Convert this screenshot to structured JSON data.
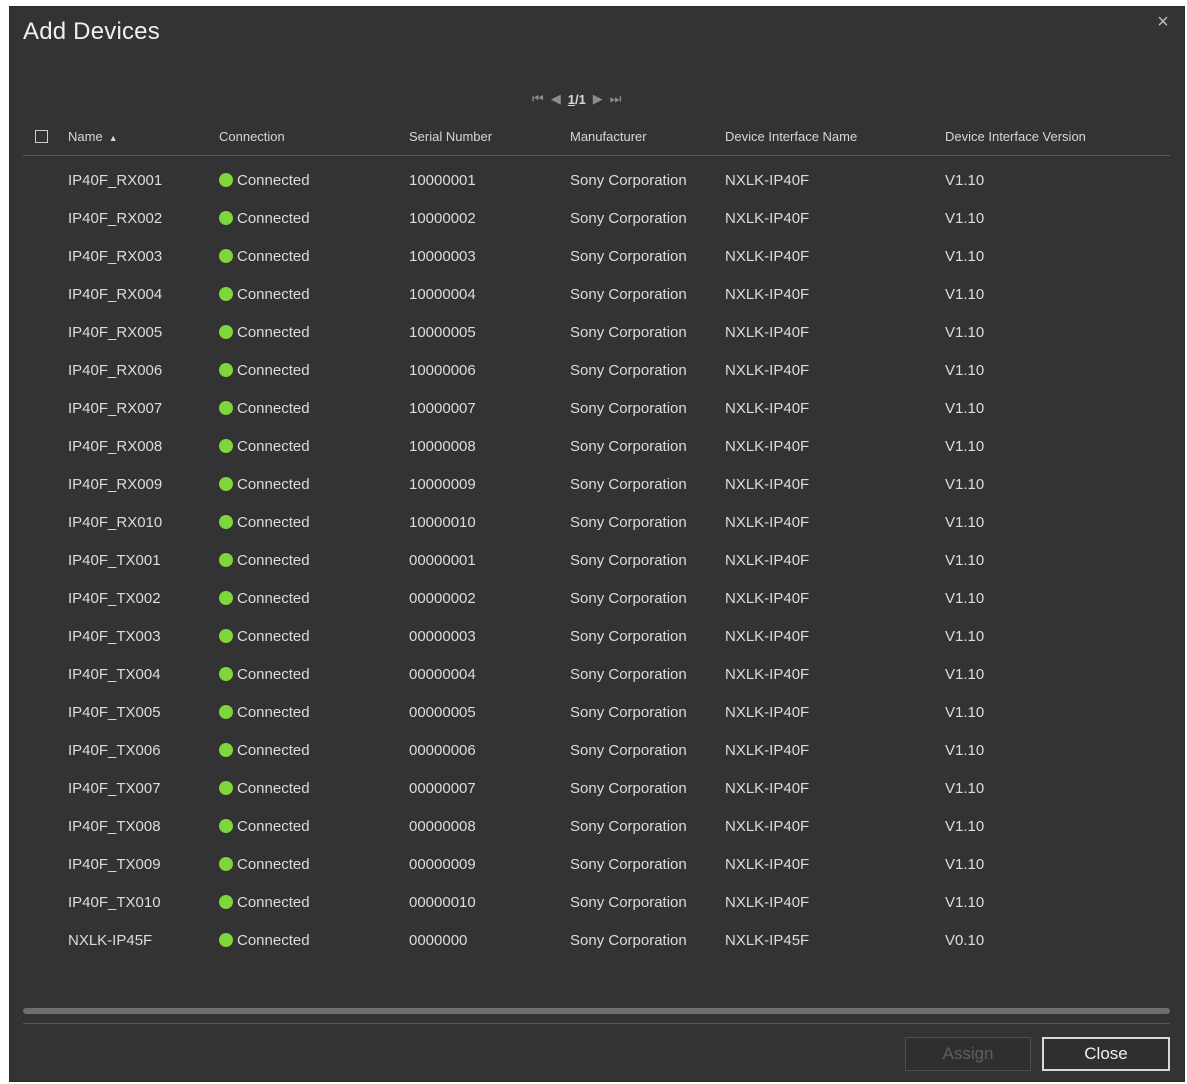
{
  "dialog": {
    "title": "Add Devices",
    "close_glyph": "×",
    "close_icon": "close-icon"
  },
  "pager": {
    "first_glyph": "⏮",
    "prev_glyph": "◀",
    "current": "1",
    "separator": "/",
    "total": "1",
    "next_glyph": "▶",
    "last_glyph": "⏭"
  },
  "table": {
    "headers": {
      "name": "Name",
      "connection": "Connection",
      "serial": "Serial Number",
      "manufacturer": "Manufacturer",
      "interface_name": "Device Interface Name",
      "interface_version": "Device Interface Version"
    },
    "sort": {
      "column": "name",
      "direction": "ascending",
      "glyph": "▲"
    },
    "status_color": "#7ed53c",
    "rows": [
      {
        "name": "IP40F_RX001",
        "connection": "Connected",
        "serial": "10000001",
        "manufacturer": "Sony Corporation",
        "interface_name": "NXLK-IP40F",
        "interface_version": "V1.10"
      },
      {
        "name": "IP40F_RX002",
        "connection": "Connected",
        "serial": "10000002",
        "manufacturer": "Sony Corporation",
        "interface_name": "NXLK-IP40F",
        "interface_version": "V1.10"
      },
      {
        "name": "IP40F_RX003",
        "connection": "Connected",
        "serial": "10000003",
        "manufacturer": "Sony Corporation",
        "interface_name": "NXLK-IP40F",
        "interface_version": "V1.10"
      },
      {
        "name": "IP40F_RX004",
        "connection": "Connected",
        "serial": "10000004",
        "manufacturer": "Sony Corporation",
        "interface_name": "NXLK-IP40F",
        "interface_version": "V1.10"
      },
      {
        "name": "IP40F_RX005",
        "connection": "Connected",
        "serial": "10000005",
        "manufacturer": "Sony Corporation",
        "interface_name": "NXLK-IP40F",
        "interface_version": "V1.10"
      },
      {
        "name": "IP40F_RX006",
        "connection": "Connected",
        "serial": "10000006",
        "manufacturer": "Sony Corporation",
        "interface_name": "NXLK-IP40F",
        "interface_version": "V1.10"
      },
      {
        "name": "IP40F_RX007",
        "connection": "Connected",
        "serial": "10000007",
        "manufacturer": "Sony Corporation",
        "interface_name": "NXLK-IP40F",
        "interface_version": "V1.10"
      },
      {
        "name": "IP40F_RX008",
        "connection": "Connected",
        "serial": "10000008",
        "manufacturer": "Sony Corporation",
        "interface_name": "NXLK-IP40F",
        "interface_version": "V1.10"
      },
      {
        "name": "IP40F_RX009",
        "connection": "Connected",
        "serial": "10000009",
        "manufacturer": "Sony Corporation",
        "interface_name": "NXLK-IP40F",
        "interface_version": "V1.10"
      },
      {
        "name": "IP40F_RX010",
        "connection": "Connected",
        "serial": "10000010",
        "manufacturer": "Sony Corporation",
        "interface_name": "NXLK-IP40F",
        "interface_version": "V1.10"
      },
      {
        "name": "IP40F_TX001",
        "connection": "Connected",
        "serial": "00000001",
        "manufacturer": "Sony Corporation",
        "interface_name": "NXLK-IP40F",
        "interface_version": "V1.10"
      },
      {
        "name": "IP40F_TX002",
        "connection": "Connected",
        "serial": "00000002",
        "manufacturer": "Sony Corporation",
        "interface_name": "NXLK-IP40F",
        "interface_version": "V1.10"
      },
      {
        "name": "IP40F_TX003",
        "connection": "Connected",
        "serial": "00000003",
        "manufacturer": "Sony Corporation",
        "interface_name": "NXLK-IP40F",
        "interface_version": "V1.10"
      },
      {
        "name": "IP40F_TX004",
        "connection": "Connected",
        "serial": "00000004",
        "manufacturer": "Sony Corporation",
        "interface_name": "NXLK-IP40F",
        "interface_version": "V1.10"
      },
      {
        "name": "IP40F_TX005",
        "connection": "Connected",
        "serial": "00000005",
        "manufacturer": "Sony Corporation",
        "interface_name": "NXLK-IP40F",
        "interface_version": "V1.10"
      },
      {
        "name": "IP40F_TX006",
        "connection": "Connected",
        "serial": "00000006",
        "manufacturer": "Sony Corporation",
        "interface_name": "NXLK-IP40F",
        "interface_version": "V1.10"
      },
      {
        "name": "IP40F_TX007",
        "connection": "Connected",
        "serial": "00000007",
        "manufacturer": "Sony Corporation",
        "interface_name": "NXLK-IP40F",
        "interface_version": "V1.10"
      },
      {
        "name": "IP40F_TX008",
        "connection": "Connected",
        "serial": "00000008",
        "manufacturer": "Sony Corporation",
        "interface_name": "NXLK-IP40F",
        "interface_version": "V1.10"
      },
      {
        "name": "IP40F_TX009",
        "connection": "Connected",
        "serial": "00000009",
        "manufacturer": "Sony Corporation",
        "interface_name": "NXLK-IP40F",
        "interface_version": "V1.10"
      },
      {
        "name": "IP40F_TX010",
        "connection": "Connected",
        "serial": "00000010",
        "manufacturer": "Sony Corporation",
        "interface_name": "NXLK-IP40F",
        "interface_version": "V1.10"
      },
      {
        "name": "NXLK-IP45F",
        "connection": "Connected",
        "serial": "0000000",
        "manufacturer": "Sony Corporation",
        "interface_name": "NXLK-IP45F",
        "interface_version": "V0.10"
      }
    ]
  },
  "footer": {
    "assign_label": "Assign",
    "assign_enabled": false,
    "close_label": "Close"
  }
}
